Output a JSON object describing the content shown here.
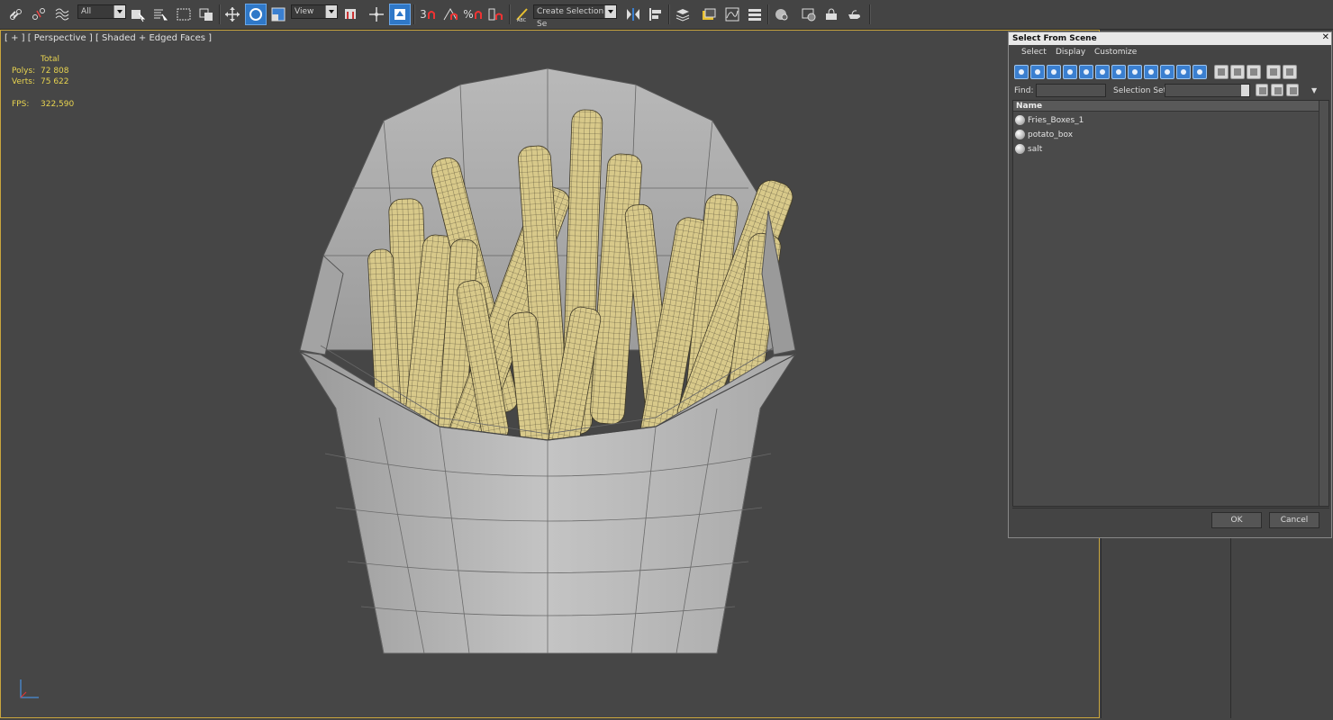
{
  "toolbar": {
    "filter_value": "All",
    "refcoord_value": "View",
    "snap_label": "3",
    "percent_label": "%",
    "selection_set_placeholder": "Create Selection Se",
    "icons": [
      "link-icon",
      "unlink-icon",
      "bind-space-warp-icon",
      "select-object-icon",
      "select-by-name-icon",
      "rect-region-icon",
      "window-crossing-icon",
      "move-icon",
      "rotate-icon",
      "scale-icon",
      "use-pivot-icon",
      "select-manipulate-icon",
      "snap-toggle-icon",
      "angle-snap-icon",
      "percent-snap-icon",
      "spinner-snap-icon",
      "edit-named-sets-icon",
      "mirror-icon",
      "align-icon",
      "layer-manager-icon",
      "scene-explorer-icon",
      "curve-editor-icon",
      "schematic-view-icon",
      "material-editor-icon",
      "render-setup-icon",
      "rendered-frame-icon",
      "render-icon"
    ],
    "active_color": "#2f78c8"
  },
  "viewport": {
    "label": "[ + ] [ Perspective ] [ Shaded + Edged Faces ]",
    "stats_header": "Total",
    "polys_label": "Polys:",
    "polys_value": "72 808",
    "verts_label": "Verts:",
    "verts_value": "75 622",
    "fps_label": "FPS:",
    "fps_value": "322,590",
    "border_color": "#c9a53d",
    "stats_color": "#e8d450"
  },
  "dialog": {
    "title": "Select From Scene",
    "close": "✕",
    "menus": [
      "Select",
      "Display",
      "Customize"
    ],
    "find_label": "Find:",
    "selection_set_label": "Selection Set:",
    "column_header": "Name",
    "items": [
      "Fries_Boxes_1",
      "potato_box",
      "salt"
    ],
    "ok": "OK",
    "cancel": "Cancel"
  }
}
